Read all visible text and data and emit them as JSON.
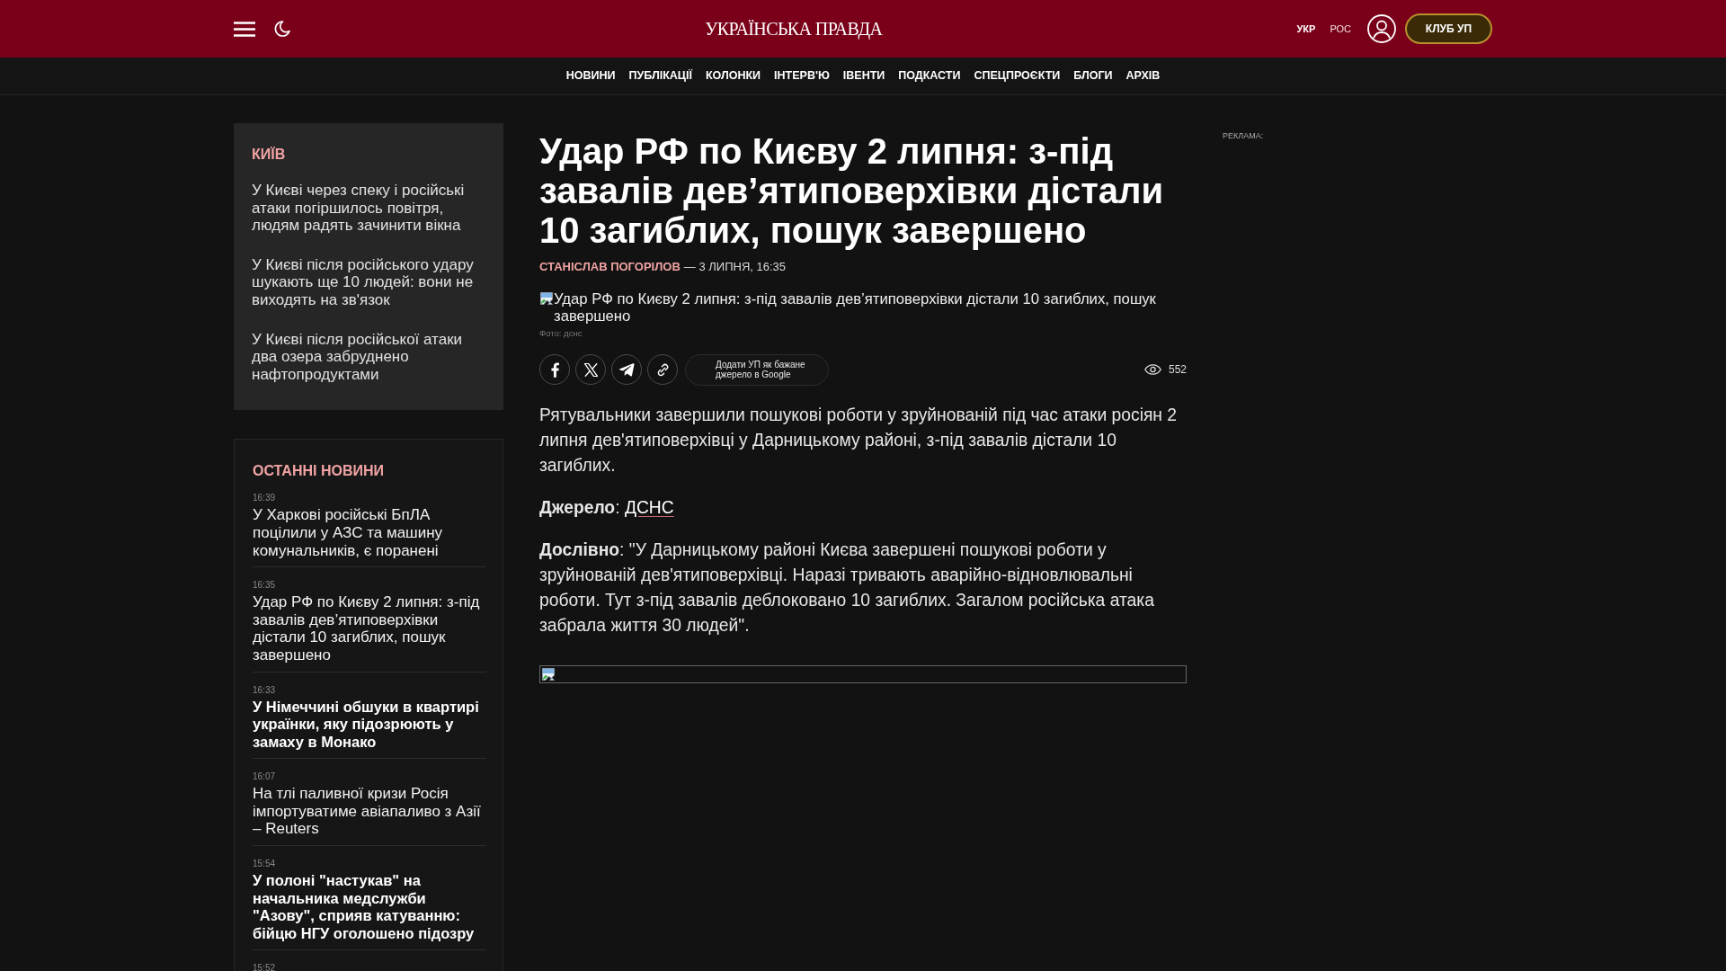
{
  "header": {
    "logo": "УКРАЇНСЬКА ПРАВДА",
    "languages": [
      {
        "label": "УКР",
        "selected": true
      },
      {
        "label": "РОС",
        "selected": false
      }
    ],
    "club_button": "КЛУБ УП"
  },
  "nav": {
    "items": [
      "НОВИНИ",
      "ПУБЛІКАЦІЇ",
      "КОЛОНКИ",
      "ІНТЕРВ'Ю",
      "ІВЕНТИ",
      "ПОДКАСТИ",
      "СПЕЦПРОЄКТИ",
      "БЛОГИ",
      "АРХІВ"
    ]
  },
  "sidebar": {
    "region": {
      "title": "КИЇВ",
      "items": [
        "У Києві через спеку і російські атаки погіршилось повітря, людям радять зачинити вікна",
        "У Києві після російського удару шукають ще 10 людей: вони не виходять на зв'язок",
        "У Києві після російської атаки два озера забруднено нафтопродуктами"
      ]
    },
    "latest_news": {
      "title": "ОСТАННІ НОВИНИ",
      "items": [
        {
          "time": "16:39",
          "title": "У Харкові російські БпЛА поцілили у АЗС та машину комунальників, є поранені",
          "important": false
        },
        {
          "time": "16:35",
          "title": "Удар РФ по Києву 2 липня: з-під завалів дев’ятиповерхівки дістали 10 загиблих, пошук завершено",
          "important": false
        },
        {
          "time": "16:33",
          "title": "У Німеччині обшуки в квартирі українки, яку підозрюють у замаху в Монако",
          "important": true
        },
        {
          "time": "16:07",
          "title": "На тлі паливної кризи Росія імпортуватиме авіапаливо з Азії – Reuters",
          "important": false
        },
        {
          "time": "15:54",
          "title": "У полоні \"настукав\" на начальника медслужби \"Азову\", сприяв катуванню: бійцю НГУ оголошено підозру",
          "important": true
        },
        {
          "time": "15:52"
        }
      ]
    }
  },
  "article": {
    "title": "Удар РФ по Києву 2 липня: з-під завалів дев’ятиповерхівки дістали 10 загиблих, пошук завершено",
    "author": "СТАНІСЛАВ ПОГОРІЛОВ",
    "date": "— 3 ЛИПНЯ, 16:35",
    "image_alt": "Удар РФ по Києву 2 липня: з-під завалів дев’ятиповерхівки дістали 10 загиблих, пошук завершено",
    "photo_credit": "Фото: дснс",
    "google_source_button": "Додати УП як бажане джерело в Google",
    "views": "552",
    "paragraphs": [
      {
        "text": "Рятувальники завершили пошукові роботи у зруйнованій під час атаки росіян 2 липня дев'ятиповерхівці у Дарницькому районі, з-під завалів дістали 10 загиблих."
      },
      {
        "text": "**Джерело**: ",
        "link": "ДСНС"
      },
      {
        "text": "**Дослівно**: \"У Дарницькому районі Києва завершені пошукові роботи у зруйнованій дев'ятиповерхівці. Наразі тривають аварійно-відновлювальні роботи. Тут з-під завалів деблоковано 10 загиблих. Загалом російська атака забрала життя 30 людей\"."
      }
    ]
  },
  "ad_label": "РЕКЛАМА:"
}
